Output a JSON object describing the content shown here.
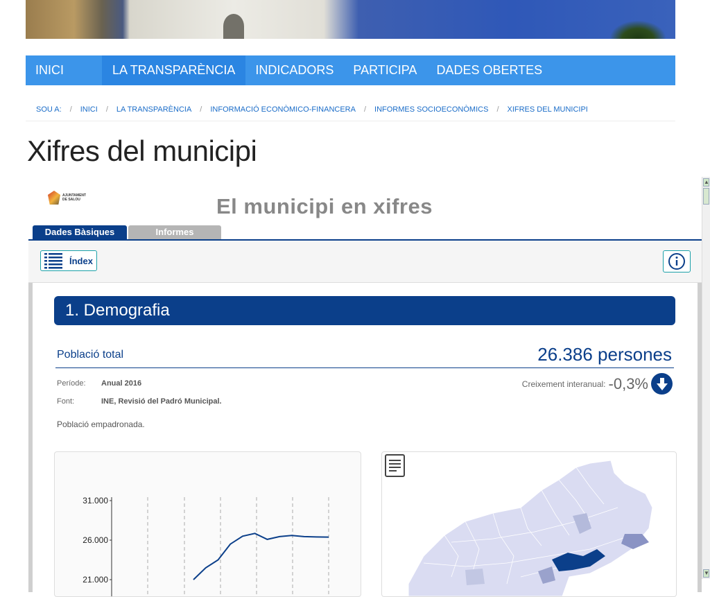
{
  "nav": {
    "items": [
      {
        "label": "INICI"
      },
      {
        "label": "LA TRANSPARÈNCIA"
      },
      {
        "label": "INDICADORS"
      },
      {
        "label": "PARTICIPA"
      },
      {
        "label": "DADES OBERTES"
      }
    ],
    "active_index": 1
  },
  "breadcrumb": {
    "prefix": "SOU A:",
    "items": [
      "INICI",
      "LA TRANSPARÈNCIA",
      "INFORMACIÓ ECONÒMICO-FINANCERA",
      "INFORMES SOCIOECONÒMICS",
      "XIFRES DEL MUNICIPI"
    ]
  },
  "page": {
    "title": "Xifres del municipi"
  },
  "app": {
    "logo_line1": "AJUNTAMENT",
    "logo_line2": "DE SALOU",
    "title": "El municipi en xifres",
    "tabs": [
      {
        "label": "Dades Bàsiques"
      },
      {
        "label": "Informes"
      }
    ],
    "index_button": "Índex"
  },
  "section": {
    "title": "1. Demografia"
  },
  "indicator": {
    "label": "Població total",
    "value": "26.386 persones",
    "period_label": "Període:",
    "period_value": "Anual 2016",
    "source_label": "Font:",
    "source_value": "INE, Revisió del Padró Municipal.",
    "growth_label": "Creixement interanual:",
    "growth_value": "-0,3%",
    "note": "Població empadronada."
  },
  "chart_data": {
    "type": "line",
    "y_tick_labels": [
      "31.000",
      "26.000",
      "21.000"
    ],
    "y_ticks": [
      31000,
      26000,
      21000
    ],
    "ylim": [
      21000,
      31000
    ],
    "series": [
      {
        "values": [
          21000,
          22500,
          23500,
          25500,
          26500,
          26850,
          26100,
          26450,
          26600,
          26450,
          26400,
          26386
        ]
      }
    ]
  },
  "colors": {
    "nav_bg": "#3c95ea",
    "nav_active": "#2b85e2",
    "primary": "#0b3f8a",
    "link": "#1a6cc8"
  }
}
